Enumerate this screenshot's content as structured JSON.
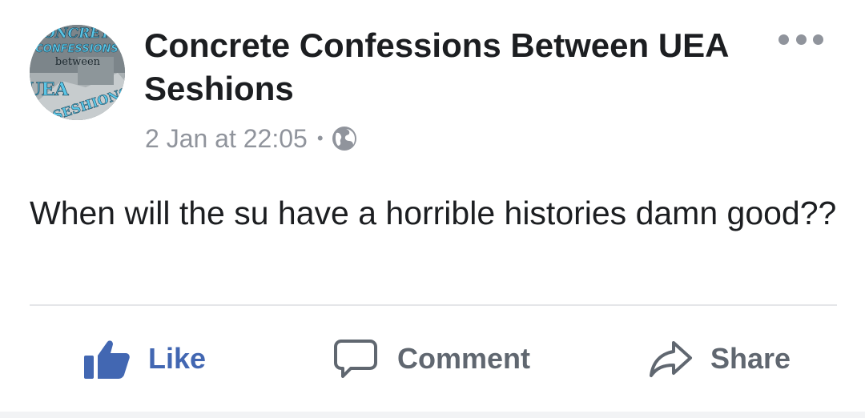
{
  "post": {
    "page_name": "Concrete Confessions Between UEA Seshions",
    "timestamp": "2 Jan at 22:05",
    "separator": "•",
    "audience_icon": "globe-icon",
    "more_icon": "more-dots-icon",
    "text": "When will the su have a horrible histories damn good??"
  },
  "avatar": {
    "lines": [
      "ONCRET",
      "CONFESSIONS",
      "between",
      "UEA",
      "SESHIONS"
    ]
  },
  "actions": {
    "like": {
      "label": "Like",
      "icon": "thumbs-up-icon",
      "color": "#4267b2"
    },
    "comment": {
      "label": "Comment",
      "icon": "comment-bubble-icon"
    },
    "share": {
      "label": "Share",
      "icon": "share-arrow-icon"
    }
  },
  "colors": {
    "text": "#1c1e21",
    "meta": "#90949c",
    "action": "#606770",
    "accent": "#4267b2",
    "divider": "#e5e6e9"
  }
}
